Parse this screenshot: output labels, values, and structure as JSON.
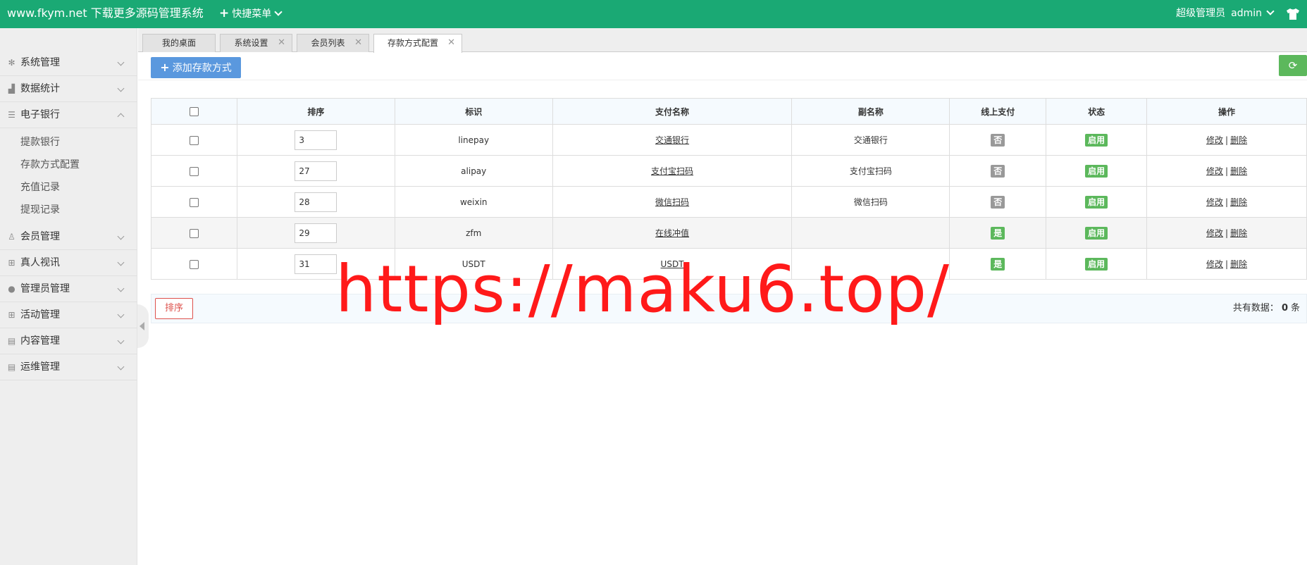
{
  "header": {
    "brand": "www.fkym.net 下载更多源码管理系统",
    "quick_menu": "快捷菜单",
    "role": "超级管理员",
    "username": "admin"
  },
  "sidebar": {
    "items": [
      {
        "label": "系统管理",
        "icon": "gear-icon"
      },
      {
        "label": "数据统计",
        "icon": "chart-icon"
      },
      {
        "label": "电子银行",
        "icon": "list-icon",
        "expanded": true,
        "children": [
          "提款银行",
          "存款方式配置",
          "充值记录",
          "提现记录"
        ]
      },
      {
        "label": "会员管理",
        "icon": "user-icon"
      },
      {
        "label": "真人视讯",
        "icon": "gift-icon"
      },
      {
        "label": "管理员管理",
        "icon": "person-icon"
      },
      {
        "label": "活动管理",
        "icon": "gift-icon"
      },
      {
        "label": "内容管理",
        "icon": "document-icon"
      },
      {
        "label": "运维管理",
        "icon": "document-icon"
      }
    ]
  },
  "tabs": [
    {
      "label": "我的桌面",
      "closable": false
    },
    {
      "label": "系统设置",
      "closable": true
    },
    {
      "label": "会员列表",
      "closable": true
    },
    {
      "label": "存款方式配置",
      "closable": true,
      "active": true
    }
  ],
  "toolbar": {
    "add_label": "添加存款方式",
    "refresh_icon": "refresh-icon"
  },
  "table": {
    "headers": [
      "排序",
      "标识",
      "支付名称",
      "副名称",
      "线上支付",
      "状态",
      "操作"
    ],
    "rows": [
      {
        "sort": "3",
        "code": "linepay",
        "name": "交通银行",
        "alias": "交通银行",
        "online": "否",
        "status": "启用",
        "edit": "修改",
        "delete": "删除"
      },
      {
        "sort": "27",
        "code": "alipay",
        "name": "支付宝扫码",
        "alias": "支付宝扫码",
        "online": "否",
        "status": "启用",
        "edit": "修改",
        "delete": "删除"
      },
      {
        "sort": "28",
        "code": "weixin",
        "name": "微信扫码",
        "alias": "微信扫码",
        "online": "否",
        "status": "启用",
        "edit": "修改",
        "delete": "删除"
      },
      {
        "sort": "29",
        "code": "zfm",
        "name": "在线冲值",
        "alias": "",
        "online": "是",
        "status": "启用",
        "edit": "修改",
        "delete": "删除"
      },
      {
        "sort": "31",
        "code": "USDT",
        "name": "USDT",
        "alias": "",
        "online": "是",
        "status": "启用",
        "edit": "修改",
        "delete": "删除"
      }
    ]
  },
  "footer": {
    "sort_button": "排序",
    "total_prefix": "共有数据：",
    "total_count": "0",
    "total_suffix": "条"
  },
  "watermark": "https://maku6.top/",
  "colors": {
    "header_bg": "#1aa974",
    "primary_button": "#5a98de",
    "success": "#5cb85c",
    "danger": "#dd514c",
    "watermark": "#ff1a1a"
  }
}
